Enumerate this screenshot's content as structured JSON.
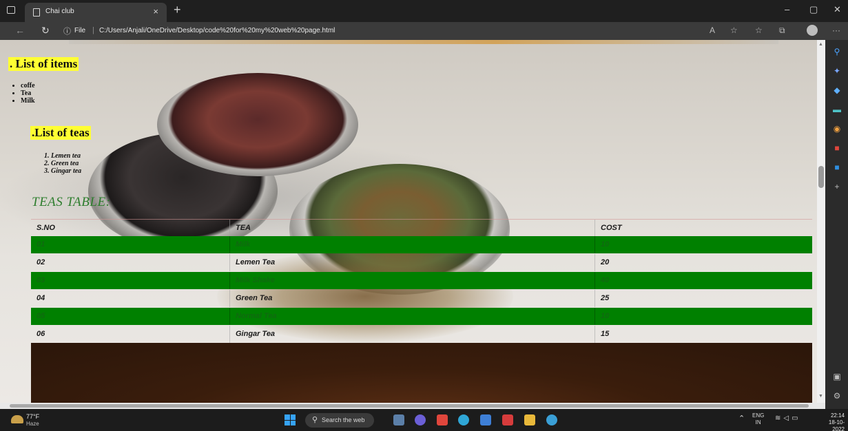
{
  "browser": {
    "tab_title": "Chai club",
    "tab_close": "×",
    "new_tab": "+",
    "addr_info_icon": "ⓘ",
    "addr_file_label": "File",
    "addr_separator": "|",
    "url": "C:/Users/Anjali/OneDrive/Desktop/code%20for%20my%20web%20page.html",
    "window_controls": {
      "minimize": "–",
      "restore": "▢",
      "close": "✕"
    },
    "more_menu": "···"
  },
  "page": {
    "items_heading": ". List of items",
    "items": [
      "coffe",
      "Tea",
      "Milk"
    ],
    "teas_heading": ".List of teas",
    "teas": [
      "1. Lemen tea",
      "2. Green tea",
      "3. Gingar tea"
    ],
    "table_title": "TEAS TABLE:",
    "table": {
      "headers": [
        "S.NO",
        "TEA",
        "COST"
      ],
      "rows": [
        [
          "01",
          "Milk",
          "10"
        ],
        [
          "02",
          "Lemen Tea",
          "20"
        ],
        [
          "03",
          "Milk Shake",
          "40"
        ],
        [
          "04",
          "Green Tea",
          "25"
        ],
        [
          "05",
          "Normal Tea",
          "10"
        ],
        [
          "06",
          "Gingar Tea",
          "15"
        ]
      ],
      "stripe_color": "#008000"
    }
  },
  "taskbar": {
    "weather_temp": "77°F",
    "weather_cond": "Haze",
    "search_placeholder": "Search the web",
    "tray_lang_line1": "ENG",
    "tray_lang_line2": "IN",
    "time": "22:14",
    "date": "18-10-2022"
  },
  "sidebar": {
    "icons": [
      "search-icon",
      "sparkle-icon",
      "tag-icon",
      "briefcase-icon",
      "games-icon",
      "office-icon",
      "outlook-icon",
      "add-icon"
    ]
  }
}
